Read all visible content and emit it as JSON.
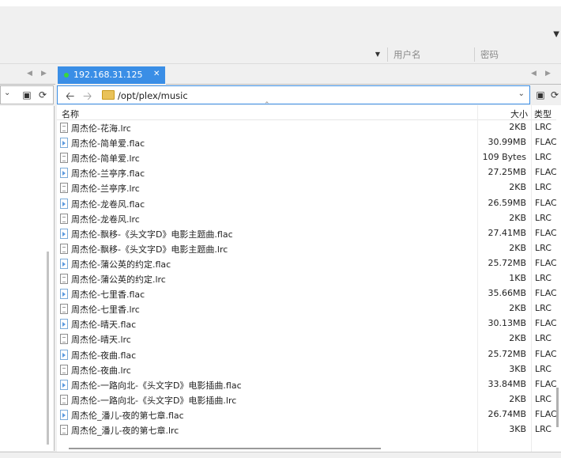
{
  "connection": {
    "username_placeholder": "用户名",
    "password_placeholder": "密码"
  },
  "tabs": [
    {
      "label": "192.168.31.125",
      "active": true,
      "status_color": "#3bd63b"
    }
  ],
  "remote": {
    "path": "/opt/plex/music",
    "columns": {
      "name": "名称",
      "size": "大小",
      "type": "类型"
    },
    "files": [
      {
        "name": "周杰伦-花海.lrc",
        "size": "2KB",
        "type": "LRC",
        "icon": "lrc-file-icon"
      },
      {
        "name": "周杰伦-简单爱.flac",
        "size": "30.99MB",
        "type": "FLAC",
        "icon": "flac-file-icon"
      },
      {
        "name": "周杰伦-简单爱.lrc",
        "size": "109 Bytes",
        "type": "LRC",
        "icon": "lrc-file-icon"
      },
      {
        "name": "周杰伦-兰亭序.flac",
        "size": "27.25MB",
        "type": "FLAC",
        "icon": "flac-file-icon"
      },
      {
        "name": "周杰伦-兰亭序.lrc",
        "size": "2KB",
        "type": "LRC",
        "icon": "lrc-file-icon"
      },
      {
        "name": "周杰伦-龙卷风.flac",
        "size": "26.59MB",
        "type": "FLAC",
        "icon": "flac-file-icon"
      },
      {
        "name": "周杰伦-龙卷风.lrc",
        "size": "2KB",
        "type": "LRC",
        "icon": "lrc-file-icon"
      },
      {
        "name": "周杰伦-飘移-《头文字D》电影主题曲.flac",
        "size": "27.41MB",
        "type": "FLAC",
        "icon": "flac-file-icon"
      },
      {
        "name": "周杰伦-飘移-《头文字D》电影主题曲.lrc",
        "size": "2KB",
        "type": "LRC",
        "icon": "lrc-file-icon"
      },
      {
        "name": "周杰伦-蒲公英的约定.flac",
        "size": "25.72MB",
        "type": "FLAC",
        "icon": "flac-file-icon"
      },
      {
        "name": "周杰伦-蒲公英的约定.lrc",
        "size": "1KB",
        "type": "LRC",
        "icon": "lrc-file-icon"
      },
      {
        "name": "周杰伦-七里香.flac",
        "size": "35.66MB",
        "type": "FLAC",
        "icon": "flac-file-icon"
      },
      {
        "name": "周杰伦-七里香.lrc",
        "size": "2KB",
        "type": "LRC",
        "icon": "lrc-file-icon"
      },
      {
        "name": "周杰伦-晴天.flac",
        "size": "30.13MB",
        "type": "FLAC",
        "icon": "flac-file-icon"
      },
      {
        "name": "周杰伦-晴天.lrc",
        "size": "2KB",
        "type": "LRC",
        "icon": "lrc-file-icon"
      },
      {
        "name": "周杰伦-夜曲.flac",
        "size": "25.72MB",
        "type": "FLAC",
        "icon": "flac-file-icon"
      },
      {
        "name": "周杰伦-夜曲.lrc",
        "size": "3KB",
        "type": "LRC",
        "icon": "lrc-file-icon"
      },
      {
        "name": "周杰伦-一路向北-《头文字D》电影插曲.flac",
        "size": "33.84MB",
        "type": "FLAC",
        "icon": "flac-file-icon"
      },
      {
        "name": "周杰伦-一路向北-《头文字D》电影插曲.lrc",
        "size": "2KB",
        "type": "LRC",
        "icon": "lrc-file-icon"
      },
      {
        "name": "周杰伦_潘儿-夜的第七章.flac",
        "size": "26.74MB",
        "type": "FLAC",
        "icon": "flac-file-icon"
      },
      {
        "name": "周杰伦_潘儿-夜的第七章.lrc",
        "size": "3KB",
        "type": "LRC",
        "icon": "lrc-file-icon"
      }
    ]
  }
}
